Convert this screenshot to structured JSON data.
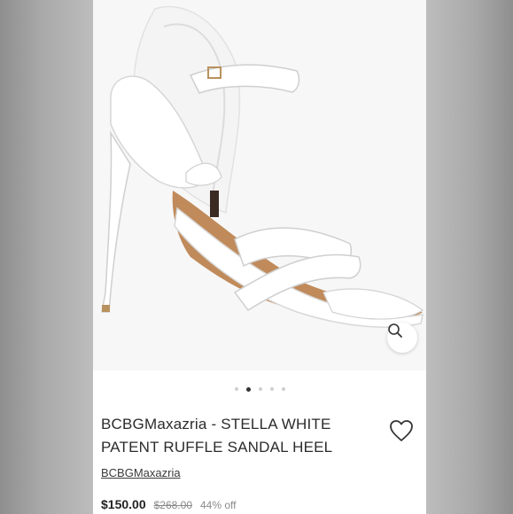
{
  "listing": {
    "title_line1": "BCBGMaxazria - STELLA WHITE",
    "title_line2": "PATENT RUFFLE SANDAL HEEL",
    "brand": "BCBGMaxazria",
    "price": "$150.00",
    "original_price": "$268.00",
    "discount": "44% off"
  },
  "gallery": {
    "slide_count": 5,
    "active_slide": 2,
    "zoom_icon": "magnifier-icon"
  },
  "icons": {
    "favorite": "heart-outline-icon"
  },
  "colors": {
    "text": "#2b2b2b",
    "muted": "#8a8a8a",
    "active_dot": "#333333"
  }
}
